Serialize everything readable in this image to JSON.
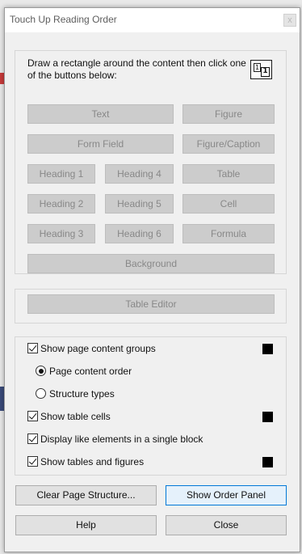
{
  "window": {
    "title": "Touch Up Reading Order",
    "close_glyph": "x"
  },
  "instructions": "Draw a rectangle around the content then click one of the buttons below:",
  "tag_buttons": {
    "text": "Text",
    "figure": "Figure",
    "form_field": "Form Field",
    "figure_caption": "Figure/Caption",
    "heading1": "Heading 1",
    "heading4": "Heading 4",
    "table": "Table",
    "heading2": "Heading 2",
    "heading5": "Heading 5",
    "cell": "Cell",
    "heading3": "Heading 3",
    "heading6": "Heading 6",
    "formula": "Formula",
    "background": "Background"
  },
  "table_editor": "Table Editor",
  "options": {
    "show_groups": {
      "label": "Show page content groups",
      "checked": true,
      "swatch_color": "#000000"
    },
    "page_order": {
      "label": "Page content order",
      "selected": true
    },
    "structure_types": {
      "label": "Structure types",
      "selected": false
    },
    "show_cells": {
      "label": "Show table cells",
      "checked": true,
      "swatch_color": "#000000"
    },
    "display_like": {
      "label": "Display like elements in a single block",
      "checked": true
    },
    "show_tables": {
      "label": "Show tables and figures",
      "checked": true,
      "swatch_color": "#000000"
    }
  },
  "buttons": {
    "clear": "Clear Page Structure...",
    "show_order": "Show Order Panel",
    "help": "Help",
    "close": "Close"
  },
  "icons": {
    "order_icon_glyph_small": "1",
    "order_icon_glyph_large": "1"
  },
  "colors": {
    "disabled_button": "#cccccc",
    "disabled_text": "#888888",
    "default_button_border": "#0078d7"
  }
}
